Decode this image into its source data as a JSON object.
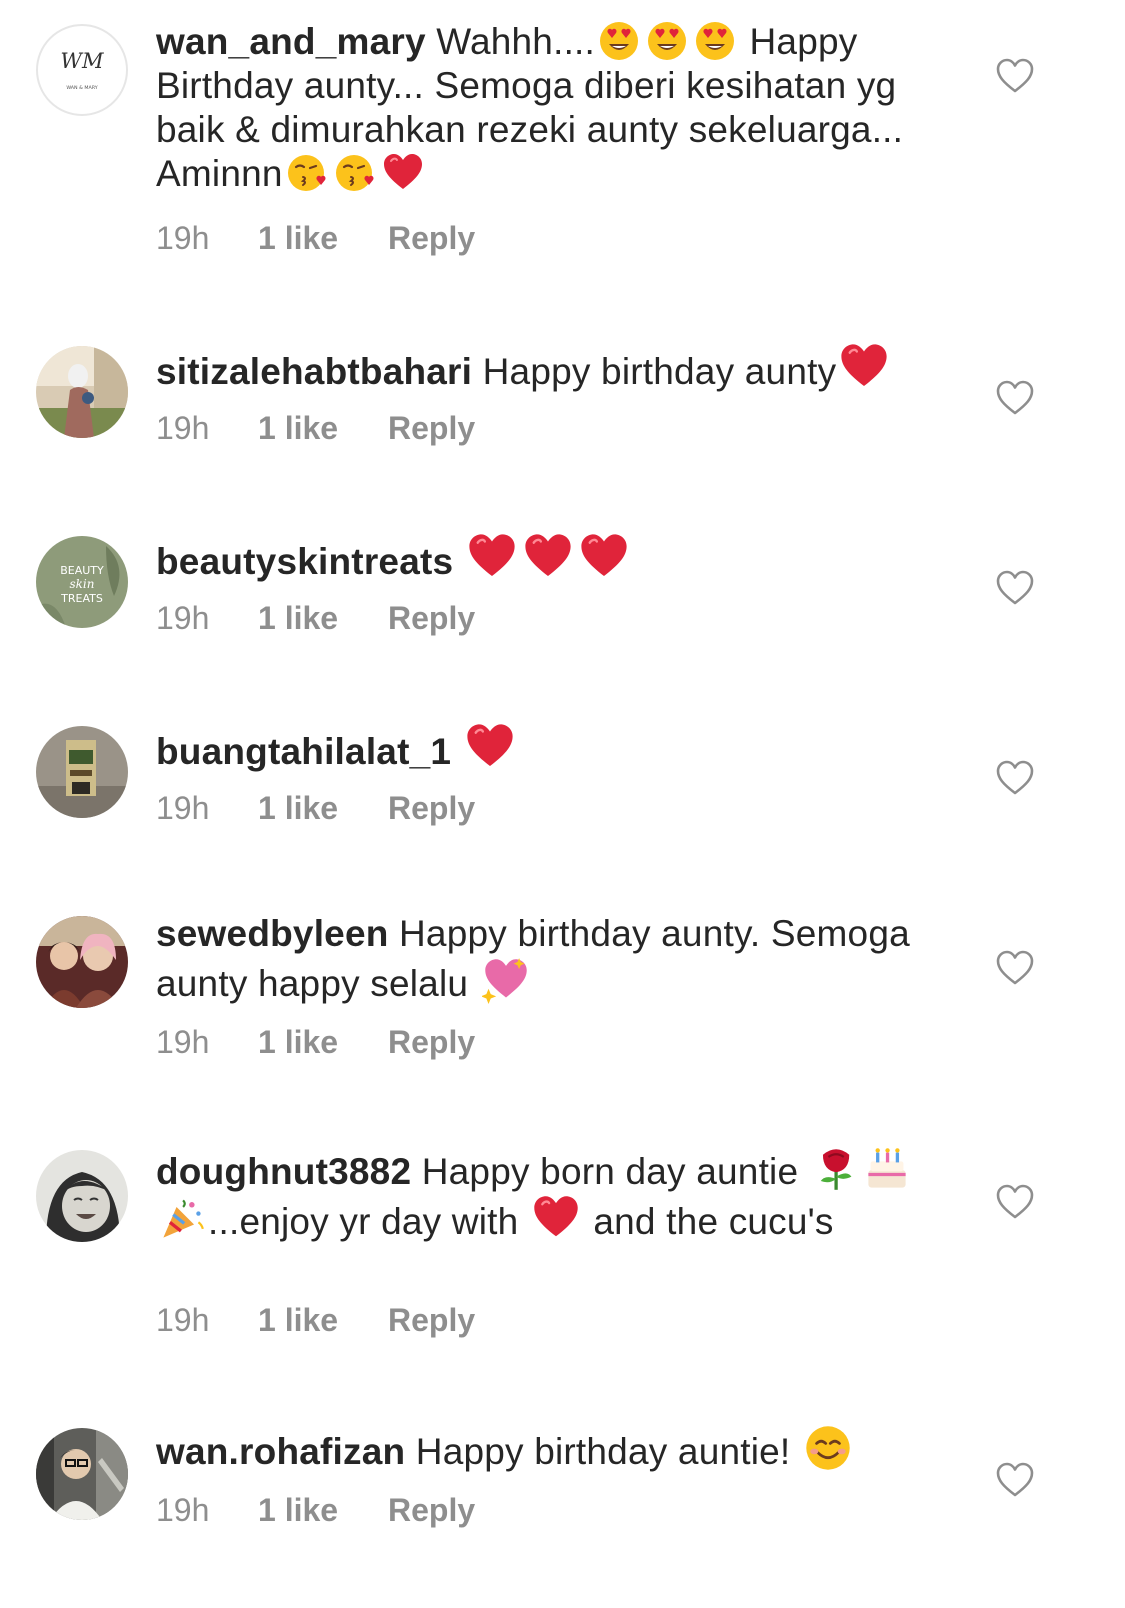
{
  "comments": [
    {
      "username": "wan_and_mary",
      "text_parts": [
        " Wahhh....",
        " Happy Birthday aunty... Semoga diberi kesihatan yg baik & dimurahkan rezeki aunty sekeluarga... Aminnn"
      ],
      "time": "19h",
      "likes": "1 like",
      "reply": "Reply",
      "avatar_text": "WM",
      "avatar_subtext": "WAN & MARY"
    },
    {
      "username": "sitizalehabtbahari",
      "text": " Happy birthday aunty",
      "time": "19h",
      "likes": "1 like",
      "reply": "Reply"
    },
    {
      "username": "beautyskintreats",
      "text": " ",
      "time": "19h",
      "likes": "1 like",
      "reply": "Reply",
      "avatar_text": [
        "BEAUTY",
        "skin",
        "TREATS"
      ]
    },
    {
      "username": "buangtahilalat_1",
      "text": " ",
      "time": "19h",
      "likes": "1 like",
      "reply": "Reply"
    },
    {
      "username": "sewedbyleen",
      "text": " Happy birthday aunty. Semoga aunty happy selalu ",
      "time": "19h",
      "likes": "1 like",
      "reply": "Reply"
    },
    {
      "username": "doughnut3882",
      "text_parts": [
        " Happy born day auntie ",
        "...enjoy yr day with ",
        " and the cucu's"
      ],
      "time": "19h",
      "likes": "1 like",
      "reply": "Reply"
    },
    {
      "username": "wan.rohafizan",
      "text": " Happy birthday auntie! ",
      "time": "19h",
      "likes": "1 like",
      "reply": "Reply"
    }
  ],
  "icons": {
    "like": "heart-outline-icon",
    "emoji_heart_eyes": "heart-eyes-emoji",
    "emoji_kiss": "kissing-heart-emoji",
    "emoji_red_heart": "red-heart-emoji",
    "emoji_sparkling_heart": "sparkling-heart-emoji",
    "emoji_rose": "rose-emoji",
    "emoji_cake": "birthday-cake-emoji",
    "emoji_party": "party-popper-emoji",
    "emoji_smile": "smiling-face-emoji"
  },
  "colors": {
    "text": "#262626",
    "secondary": "#8e8e8e",
    "heart_red": "#e0243a"
  }
}
